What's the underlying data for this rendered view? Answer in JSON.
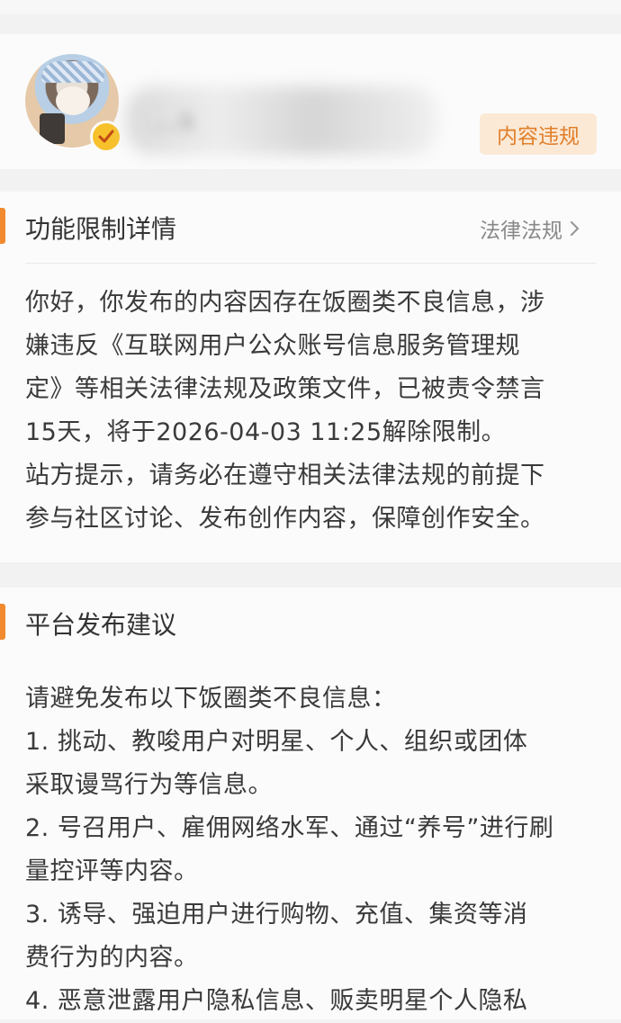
{
  "user": {
    "name": "…s",
    "tag": "内容违规"
  },
  "detail": {
    "title": "功能限制详情",
    "link": "法律法规",
    "lines": [
      "你好，你发布的内容因存在饭圈类不良信息，涉",
      "嫌违反《互联网用户公众账号信息服务管理规",
      "定》等相关法律法规及政策文件，已被责令禁言",
      "15天，将于2026-04-03 11:25解除限制。",
      "站方提示，请务必在遵守相关法律法规的前提下",
      "参与社区讨论、发布创作内容，保障创作安全。"
    ]
  },
  "advice": {
    "title": "平台发布建议",
    "lines": [
      "请避免发布以下饭圈类不良信息：",
      "1. 挑动、教唆用户对明星、个人、组织或团体",
      "采取谩骂行为等信息。",
      "2. 号召用户、雇佣网络水军、通过“养号”进行刷",
      "量控评等内容。",
      "3. 诱导、强迫用户进行购物、充值、集资等消",
      "费行为的内容。",
      "4. 恶意泄露用户隐私信息、贩卖明星个人隐私"
    ]
  },
  "colors": {
    "accent": "#f28a2e",
    "tag_bg": "#fbe9d6",
    "tag_text": "#e17f2a",
    "badge": "#f7c12b"
  },
  "icons": {
    "verify": "verified-badge-icon",
    "chevron": "chevron-right-icon"
  }
}
